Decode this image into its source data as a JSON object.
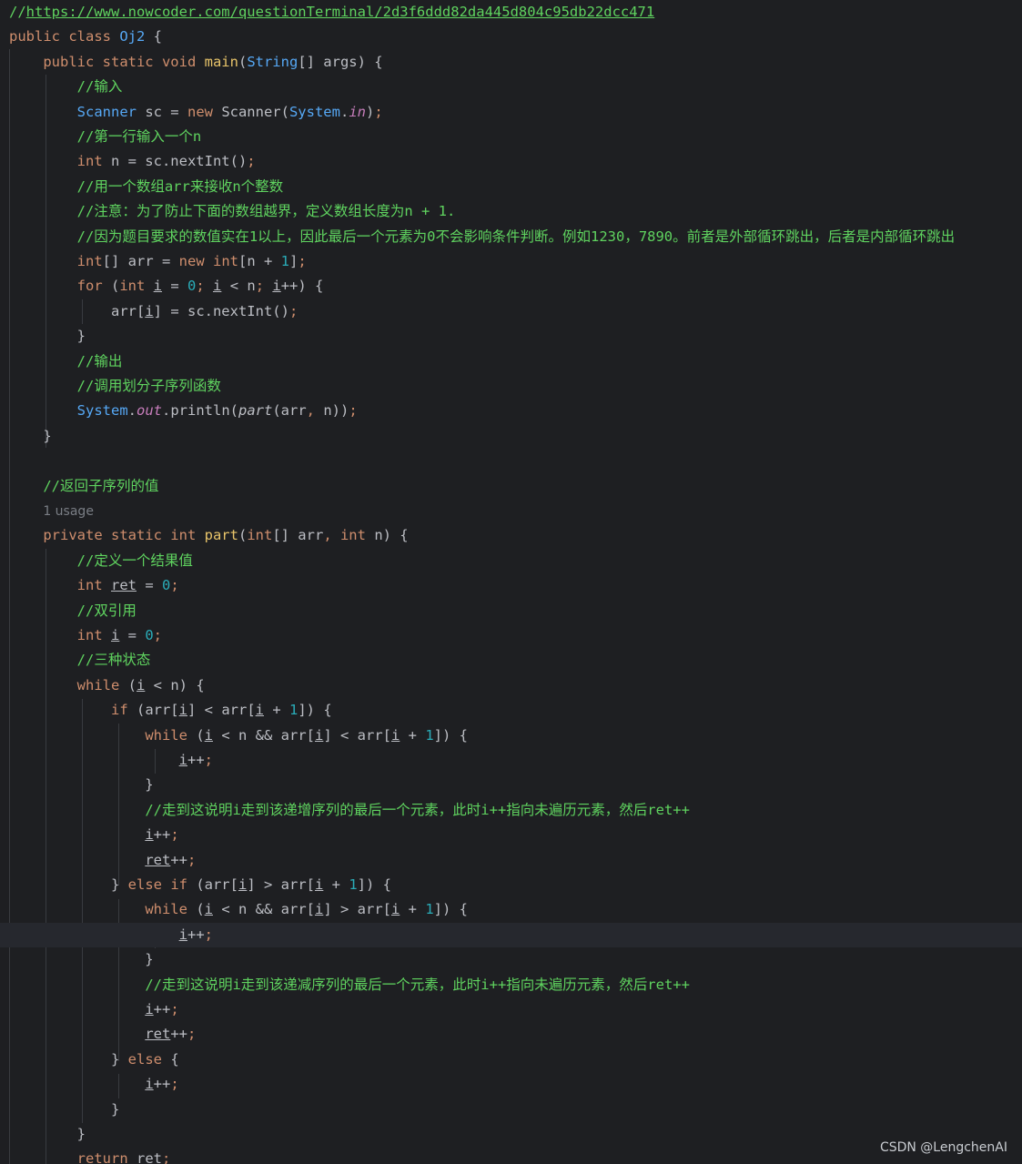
{
  "lines": {
    "l1": "https://www.nowcoder.com/questionTerminal/2d3f6ddd82da445d804c95db22dcc471",
    "l2_class": "Oj2",
    "c_input": "//输入",
    "c_firstline": "//第一行输入一个n",
    "c_arr": "//用一个数组arr来接收n个整数",
    "c_note": "//注意：为了防止下面的数组越界，定义数组长度为n + 1.",
    "c_because": "//因为题目要求的数值实在1以上，因此最后一个元素为0不会影响条件判断。例如1230，7890。前者是外部循环跳出，后者是内部循环跳出",
    "c_output": "//输出",
    "c_call": "//调用划分子序列函数",
    "c_return": "//返回子序列的值",
    "usage": "1 usage",
    "c_result": "//定义一个结果值",
    "c_double": "//双引用",
    "c_three": "//三种状态",
    "c_inc": "//走到这说明i走到该递增序列的最后一个元素，此时i++指向未遍历元素，然后ret++",
    "c_dec": "//走到这说明i走到该递减序列的最后一个元素，此时i++指向未遍历元素，然后ret++"
  },
  "watermark": "CSDN @LengchenAI"
}
